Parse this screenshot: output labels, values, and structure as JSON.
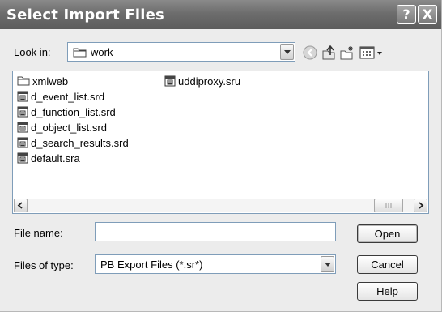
{
  "dialog": {
    "title": "Select Import Files",
    "help_button": "?",
    "close_button": "X"
  },
  "lookin": {
    "label": "Look in:",
    "value": "work",
    "icons": [
      "folder-icon",
      "back-icon",
      "up-folder-icon",
      "new-folder-icon",
      "view-menu-icon"
    ]
  },
  "files": {
    "col1": [
      {
        "name": "xmlweb",
        "icon": "folder-icon"
      },
      {
        "name": "d_event_list.srd",
        "icon": "file-icon"
      },
      {
        "name": "d_function_list.srd",
        "icon": "file-icon"
      },
      {
        "name": "d_object_list.srd",
        "icon": "file-icon"
      },
      {
        "name": "d_search_results.srd",
        "icon": "file-icon"
      },
      {
        "name": "default.sra",
        "icon": "file-icon"
      }
    ],
    "col2": [
      {
        "name": "uddiproxy.sru",
        "icon": "file-icon"
      }
    ]
  },
  "scrollbar": {
    "left_arrow": "<",
    "right_arrow": ">",
    "thumb_grip": "III"
  },
  "filename": {
    "label": "File name:",
    "value": ""
  },
  "filetype": {
    "label": "Files of type:",
    "value": "PB Export Files (*.sr*)"
  },
  "buttons": {
    "open": "Open",
    "cancel": "Cancel",
    "help": "Help"
  }
}
